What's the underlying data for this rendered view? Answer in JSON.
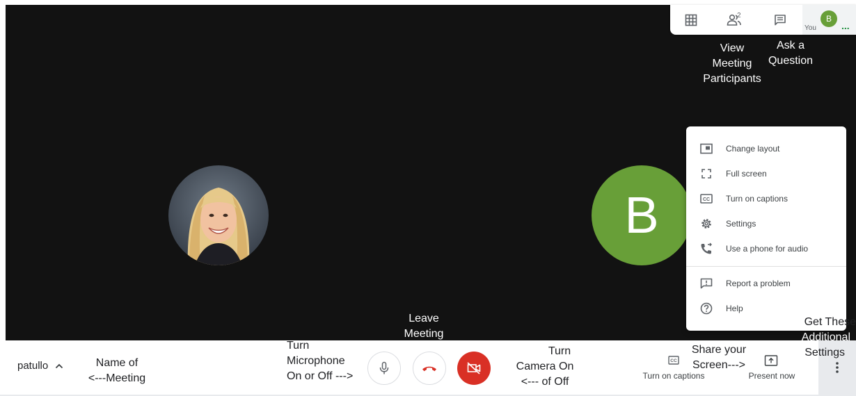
{
  "top_bar": {
    "participant_count": "2",
    "you_label": "You",
    "you_initial": "B",
    "you_more": "..."
  },
  "tiles": {
    "participant_initial": "B"
  },
  "annotations": {
    "view_participants": [
      "View",
      "Meeting",
      "Participants"
    ],
    "ask_question": [
      "Ask a",
      "Question"
    ],
    "leave_meeting": [
      "Leave",
      "Meeting"
    ],
    "meeting_name": [
      "Name of",
      "<---Meeting"
    ],
    "microphone": [
      "Turn",
      "Microphone",
      "On or Off --->"
    ],
    "camera": [
      "Turn",
      "Camera On",
      "<--- of Off"
    ],
    "share_screen": [
      "Share your",
      "Screen--->"
    ],
    "additional_settings": [
      "Get These",
      "Additional",
      "Settings"
    ]
  },
  "menu": {
    "items": [
      {
        "label": "Change layout",
        "icon": "change-layout-icon"
      },
      {
        "label": "Full screen",
        "icon": "fullscreen-icon"
      },
      {
        "label": "Turn on captions",
        "icon": "captions-icon"
      },
      {
        "label": "Settings",
        "icon": "gear-icon"
      },
      {
        "label": "Use a phone for audio",
        "icon": "phone-audio-icon"
      },
      {
        "label": "Report a problem",
        "icon": "report-problem-icon"
      },
      {
        "label": "Help",
        "icon": "help-icon"
      }
    ]
  },
  "bottom_bar": {
    "meeting_name": "patullo",
    "captions_label": "Turn on captions",
    "present_label": "Present now"
  },
  "colors": {
    "stage_bg": "#121212",
    "avatar_green": "#689f38",
    "hangup_red": "#d93025"
  }
}
